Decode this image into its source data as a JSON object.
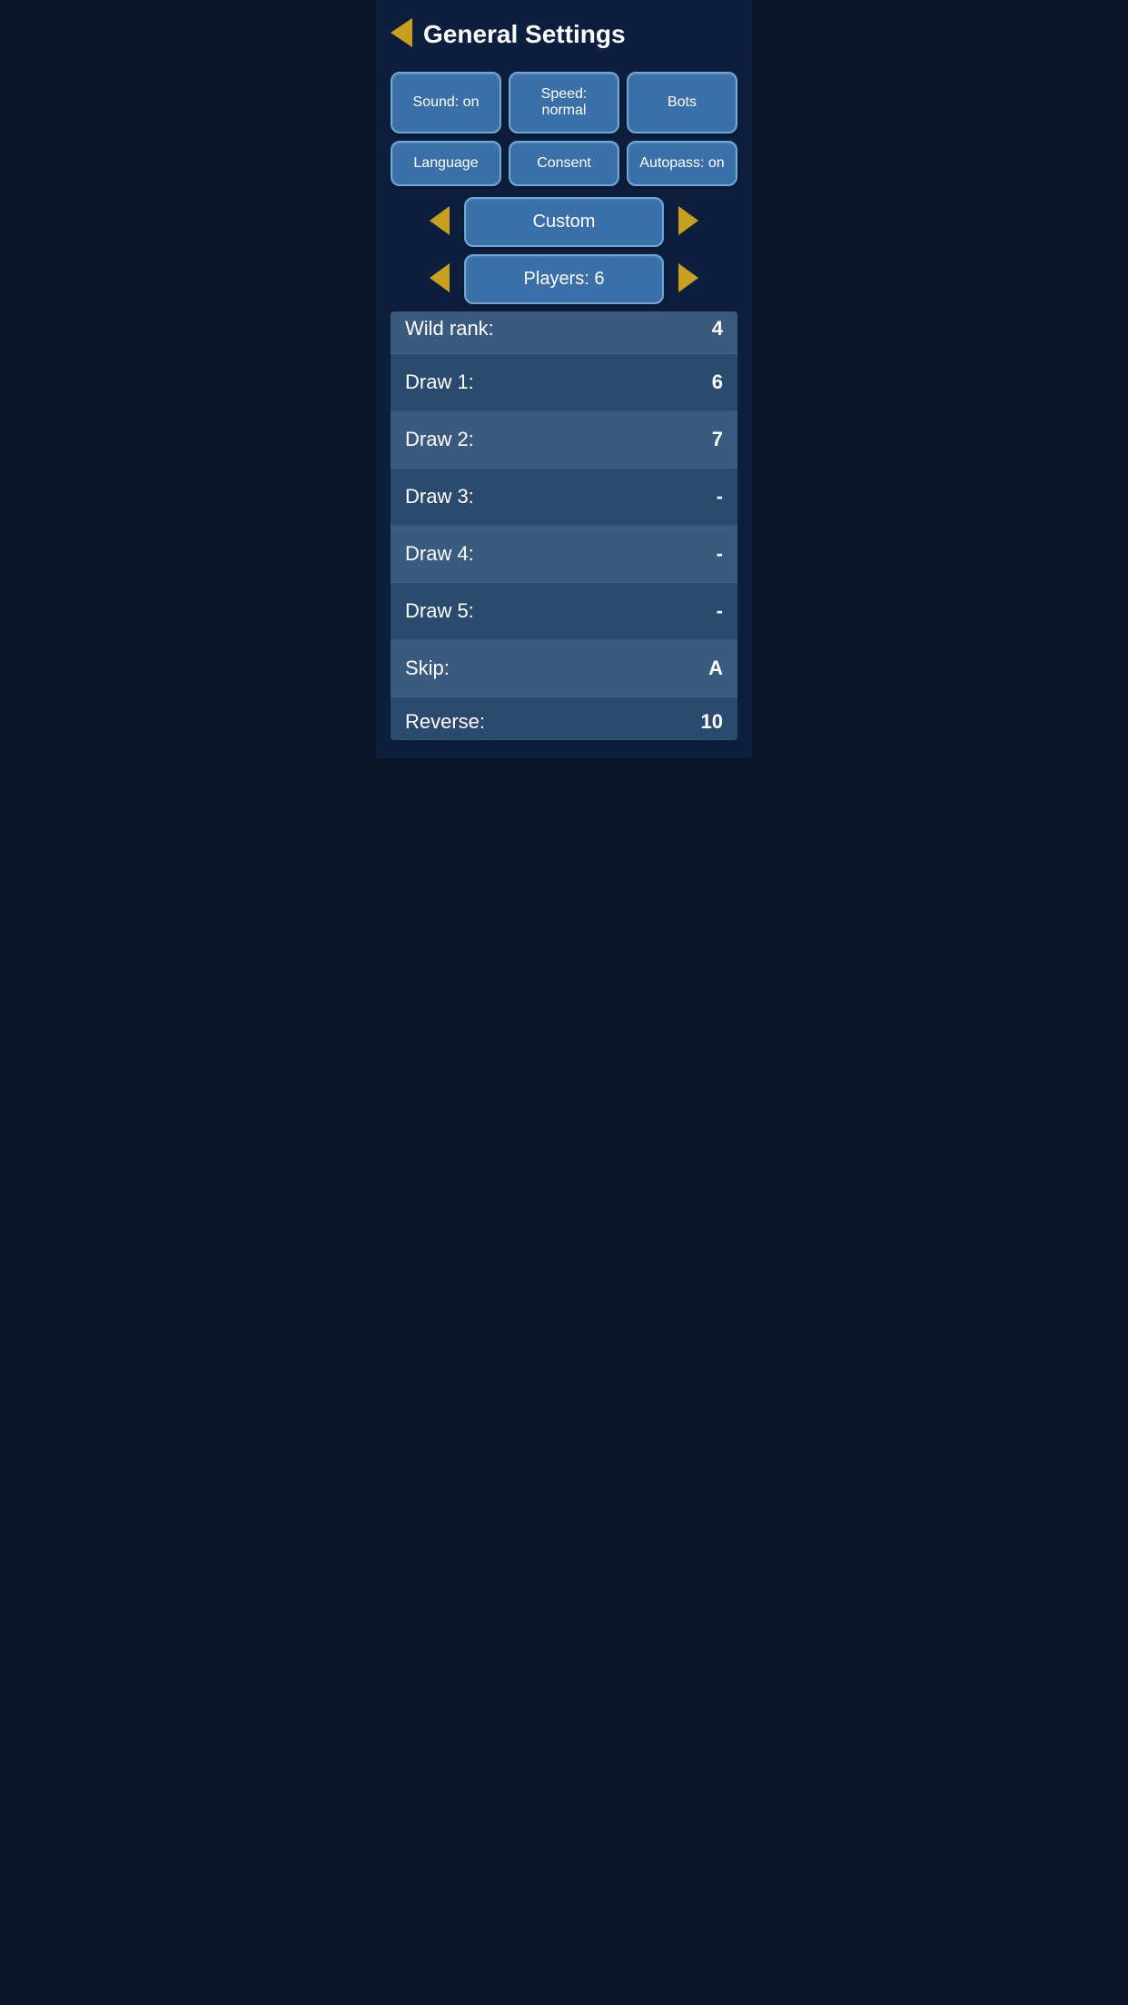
{
  "header": {
    "title": "General Settings",
    "back_label": "back"
  },
  "buttons": {
    "sound": "Sound: on",
    "speed": "Speed: normal",
    "bots": "Bots",
    "language": "Language",
    "consent": "Consent",
    "autopass": "Autopass: on"
  },
  "preset_nav": {
    "label": "Custom",
    "left_arrow": "◄",
    "right_arrow": "►"
  },
  "players_nav": {
    "label": "Players: 6",
    "left_arrow": "◄",
    "right_arrow": "►"
  },
  "table": {
    "rows": [
      {
        "label": "Wild rank:",
        "value": "4"
      },
      {
        "label": "Draw 1:",
        "value": "6"
      },
      {
        "label": "Draw 2:",
        "value": "7"
      },
      {
        "label": "Draw 3:",
        "value": "-"
      },
      {
        "label": "Draw 4:",
        "value": "-"
      },
      {
        "label": "Draw 5:",
        "value": "-"
      },
      {
        "label": "Skip:",
        "value": "A"
      },
      {
        "label": "Reverse:",
        "value": "10"
      }
    ]
  },
  "colors": {
    "background": "#0d1f3c",
    "button_bg": "#3a6fa8",
    "button_border": "#6ea8d8",
    "arrow": "#c8a020",
    "row_odd": "#2a4a6e",
    "row_even": "#3a5a7e"
  }
}
